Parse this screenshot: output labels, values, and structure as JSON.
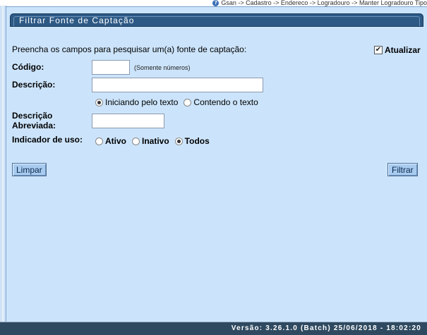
{
  "breadcrumb": {
    "text": "Gsan -> Cadastro -> Endereco -> Logradouro -> Manter Logradouro Tipo"
  },
  "panel": {
    "title": "Filtrar Fonte de Captação"
  },
  "form": {
    "intro": "Preencha os campos para pesquisar um(a) fonte de captação:",
    "atualizar_label": "Atualizar",
    "atualizar_checked": true,
    "codigo_label": "Código:",
    "codigo_value": "",
    "codigo_hint": "(Somente números)",
    "descricao_label": "Descrição:",
    "descricao_value": "",
    "search_mode": {
      "option1": "Iniciando pelo texto",
      "option2": "Contendo o texto",
      "selected": "Iniciando pelo texto"
    },
    "descricao_abreviada_label_line1": "Descrição",
    "descricao_abreviada_label_line2": "Abreviada:",
    "descricao_abreviada_value": "",
    "indicador_label": "Indicador de uso:",
    "indicador": {
      "ativo": "Ativo",
      "inativo": "Inativo",
      "todos": "Todos",
      "selected": "Todos"
    }
  },
  "buttons": {
    "limpar": "Limpar",
    "filtrar": "Filtrar"
  },
  "footer": {
    "version": "Versão: 3.26.1.0 (Batch) 25/06/2018 - 18:02:20"
  },
  "colors": {
    "content_bg": "#cce4fb",
    "header_bg": "#2d5985",
    "footer_bg": "#2f4a60",
    "button_bg": "#a8cbf0"
  }
}
